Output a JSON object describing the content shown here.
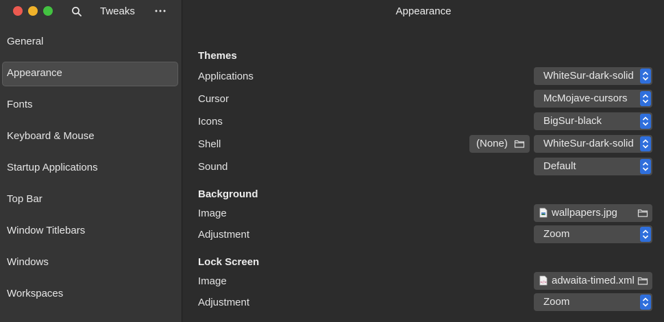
{
  "sidebar": {
    "app_title": "Tweaks",
    "items": [
      {
        "label": "General"
      },
      {
        "label": "Appearance"
      },
      {
        "label": "Fonts"
      },
      {
        "label": "Keyboard & Mouse"
      },
      {
        "label": "Startup Applications"
      },
      {
        "label": "Top Bar"
      },
      {
        "label": "Window Titlebars"
      },
      {
        "label": "Windows"
      },
      {
        "label": "Workspaces"
      }
    ],
    "selected": "Appearance"
  },
  "main": {
    "title": "Appearance",
    "themes": {
      "heading": "Themes",
      "applications": {
        "label": "Applications",
        "value": "WhiteSur-dark-solid"
      },
      "cursor": {
        "label": "Cursor",
        "value": "McMojave-cursors"
      },
      "icons": {
        "label": "Icons",
        "value": "BigSur-black"
      },
      "shell": {
        "label": "Shell",
        "file_value": "(None)",
        "value": "WhiteSur-dark-solid"
      },
      "sound": {
        "label": "Sound",
        "value": "Default"
      }
    },
    "background": {
      "heading": "Background",
      "image": {
        "label": "Image",
        "value": "wallpapers.jpg"
      },
      "adjustment": {
        "label": "Adjustment",
        "value": "Zoom"
      }
    },
    "lock_screen": {
      "heading": "Lock Screen",
      "image": {
        "label": "Image",
        "value": "adwaita-timed.xml"
      },
      "adjustment": {
        "label": "Adjustment",
        "value": "Zoom"
      }
    }
  },
  "colors": {
    "accent": "#2f6fdc",
    "close": "#ec5a50",
    "minimize": "#f0b22a",
    "maximize": "#43c241"
  }
}
